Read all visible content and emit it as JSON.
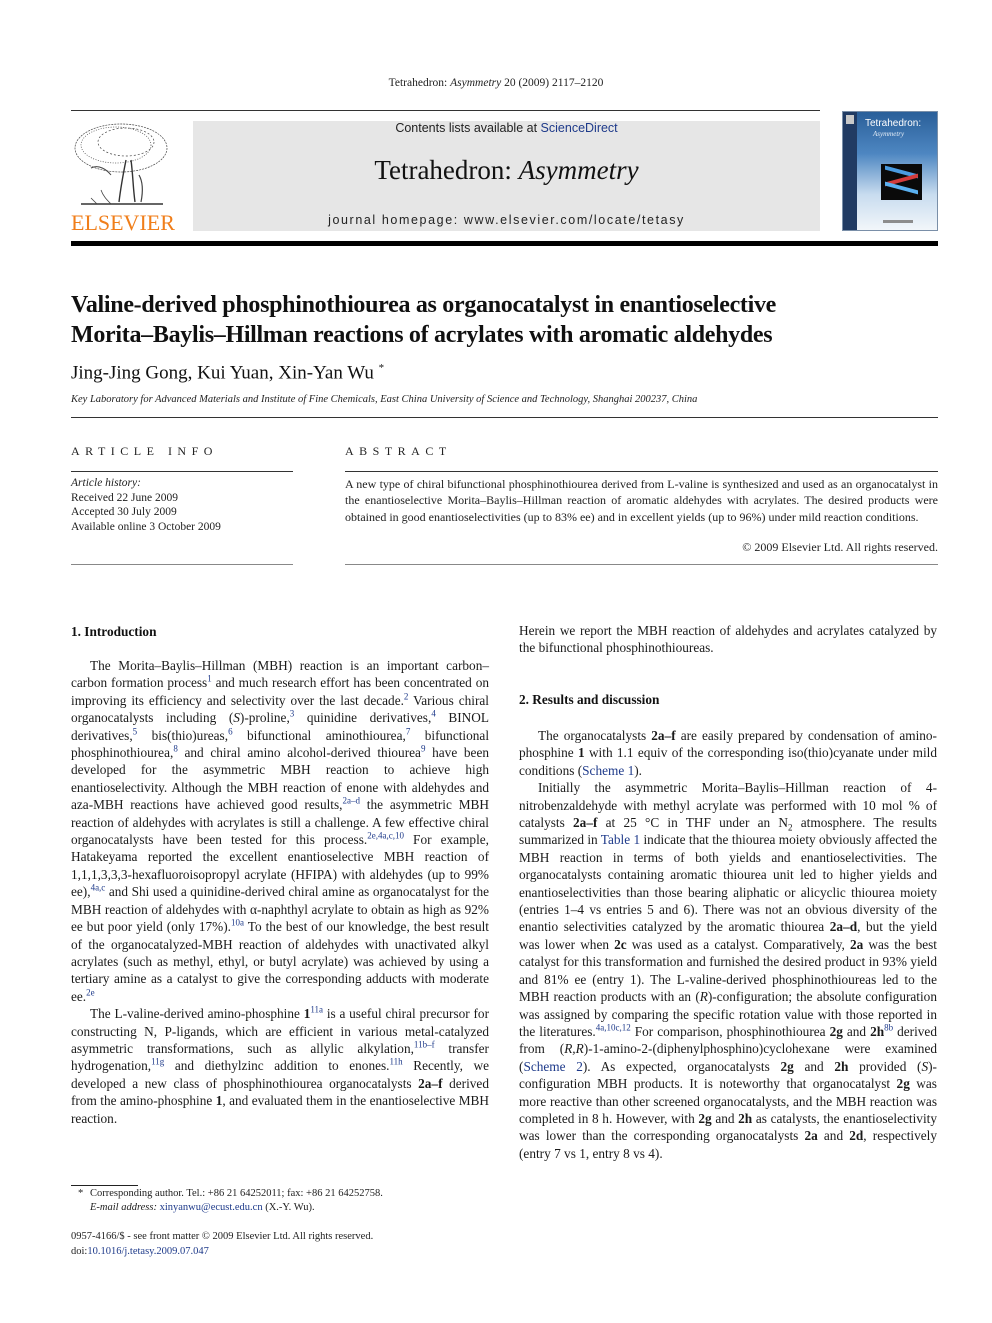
{
  "running_head": {
    "journal": "Tetrahedron:",
    "journal_italic": "Asymmetry",
    "citation": "20 (2009) 2117–2120"
  },
  "masthead": {
    "contents_prefix": "Contents lists available at",
    "contents_link": "ScienceDirect",
    "journal_name": "Tetrahedron:",
    "journal_name_italic": "Asymmetry",
    "homepage_label": "journal homepage:",
    "homepage_url": "www.elsevier.com/locate/tetasy",
    "publisher_logo_text": "ELSEVIER",
    "cover_title": "Tetrahedron:",
    "cover_subtitle": "Asymmetry",
    "brand_color": "#f07e1a",
    "link_color": "#1e3a8a"
  },
  "article": {
    "title_line1": "Valine-derived phosphinothiourea as organocatalyst in enantioselective",
    "title_line2": "Morita–Baylis–Hillman reactions of acrylates with aromatic aldehydes",
    "authors": "Jing-Jing Gong, Kui Yuan, Xin-Yan Wu",
    "corresponding_mark": "*",
    "affiliation": "Key Laboratory for Advanced Materials and Institute of Fine Chemicals, East China University of Science and Technology, Shanghai 200237, China"
  },
  "article_info": {
    "heading": "ARTICLE INFO",
    "history_label": "Article history:",
    "received": "Received 22 June 2009",
    "accepted": "Accepted 30 July 2009",
    "online": "Available online 3 October 2009"
  },
  "abstract": {
    "heading": "ABSTRACT",
    "text": "A new type of chiral bifunctional phosphinothiourea derived from L-valine is synthesized and used as an organocatalyst in the enantioselective Morita–Baylis–Hillman reaction of aromatic aldehydes with acrylates. The desired products were obtained in good enantioselectivities (up to 83% ee) and in excellent yields (up to 96%) under mild reaction conditions.",
    "copyright": "© 2009 Elsevier Ltd. All rights reserved."
  },
  "sections": {
    "intro_heading": "1.  Introduction",
    "results_heading": "2.  Results and discussion"
  },
  "body": {
    "intro_p1": [
      "The Morita–Baylis–Hillman (MBH) reaction is an important carbon–carbon formation process",
      "1",
      " and much research effort has been concentrated on improving its efficiency and selectivity over the last decade.",
      "2",
      " Various chiral organocatalysts including (",
      "S",
      ")-proline,",
      "3",
      " quinidine derivatives,",
      "4",
      " BINOL derivatives,",
      "5",
      " bis(thio)ureas,",
      "6",
      " bifunctional aminothiourea,",
      "7",
      " bifunctional phosphinothiourea,",
      "8",
      " and chiral amino alcohol-derived thiourea",
      "9",
      " have been developed for the asymmetric MBH reaction to achieve high enantioselectivity. Although the MBH reaction of enone with aldehydes and aza-MBH reactions have achieved good results,",
      "2a–d",
      " the asymmetric MBH reaction of aldehydes with acrylates is still a challenge. A few effective chiral organocatalysts have been tested for this process.",
      "2e,4a,c,10",
      " For example, Hatakeyama reported the excellent enantioselective MBH reaction of 1,1,1,3,3,3-hexafluoroisopropyl acrylate (HFIPA) with aldehydes (up to 99% ee),",
      "4a,c",
      " and Shi used a quinidine-derived chiral amine as organocatalyst for the MBH reaction of aldehydes with α-naphthyl acrylate to obtain as high as 92% ee but poor yield (only 17%).",
      "10a",
      " To the best of our knowledge, the best result of the organocatalyzed-MBH reaction of aldehydes with unactivated alkyl acrylates (such as methyl, ethyl, or butyl acrylate) was achieved by using a tertiary amine as a catalyst to give the corresponding adducts with moderate ee.",
      "2e"
    ],
    "intro_p2": [
      "The L-valine-derived amino-phosphine ",
      "1",
      "11a",
      " is a useful chiral precursor for constructing N, P-ligands, which are efficient in various metal-catalyzed asymmetric transformations, such as allylic alkylation,",
      "11b–f",
      " transfer hydrogenation,",
      "11g",
      " and diethylzinc addition to enones.",
      "11h",
      " Recently, we developed a new class of phosphinothiourea organocatalysts ",
      "2a–f",
      " derived from the amino-phosphine ",
      "1",
      ", and evaluated them in the enantioselective MBH reaction."
    ],
    "right_p0": "Herein we report the MBH reaction of aldehydes and acrylates catalyzed by the bifunctional phosphinothioureas.",
    "results_p1": [
      "The organocatalysts ",
      "2a–f",
      " are easily prepared by condensation of amino-phosphine ",
      "1",
      " with 1.1 equiv of the corresponding iso(thio)cyanate under mild conditions (",
      "Scheme 1",
      ")."
    ],
    "results_p2": [
      "Initially the asymmetric Morita–Baylis–Hillman reaction of 4-nitrobenzaldehyde with methyl acrylate was performed with 10 mol % of catalysts ",
      "2a–f",
      " at 25 °C in THF under an N",
      "2",
      " atmosphere. The results summarized in ",
      "Table 1",
      " indicate that the thiourea moiety obviously affected the MBH reaction in terms of both yields and enantioselectivities. The organocatalysts containing aromatic thiourea unit led to higher yields and enantioselectivities than those bearing aliphatic or alicyclic thiourea moiety (entries 1–4 vs entries 5 and 6). There was not an obvious diversity of the enantio selectivities catalyzed by the aromatic thiourea ",
      "2a–d",
      ", but the yield was lower when ",
      "2c",
      " was used as a catalyst. Comparatively, ",
      "2a",
      " was the best catalyst for this transformation and furnished the desired product in 93% yield and 81% ee (entry 1). The L-valine-derived phosphinothioureas led to the MBH reaction products with an (",
      "R",
      ")-configuration; the absolute configuration was assigned by comparing the specific rotation value with those reported in the literatures.",
      "4a,10c,12",
      " For comparison, phosphinothiourea ",
      "2g",
      " and ",
      "2h",
      "8b",
      " derived from (",
      "R,R",
      ")-1-amino-2-(diphenylphosphino)cyclohexane were examined (",
      "Scheme 2",
      "). As expected, organocatalysts ",
      "2g",
      " and ",
      "2h",
      " provided (",
      "S",
      ")-configuration MBH products. It is noteworthy that organocatalyst ",
      "2g",
      " was more reactive than other screened organocatalysts, and the MBH reaction was completed in 8 h. However, with ",
      "2g",
      " and ",
      "2h",
      " as catalysts, the enantioselectivity was lower than the corresponding organocatalysts ",
      "2a",
      " and ",
      "2d",
      ", respectively (entry 7 vs 1, entry 8 vs 4)."
    ]
  },
  "footnote": {
    "star": "*",
    "contact": "Corresponding author. Tel.: +86 21 64252011; fax: +86 21 64252758.",
    "email_label": "E-mail address:",
    "email": "xinyanwu@ecust.edu.cn",
    "email_suffix": "(X.-Y. Wu)."
  },
  "front_matter": {
    "issn_line": "0957-4166/$ - see front matter © 2009 Elsevier Ltd. All rights reserved.",
    "doi_prefix": "doi:",
    "doi": "10.1016/j.tetasy.2009.07.047"
  }
}
